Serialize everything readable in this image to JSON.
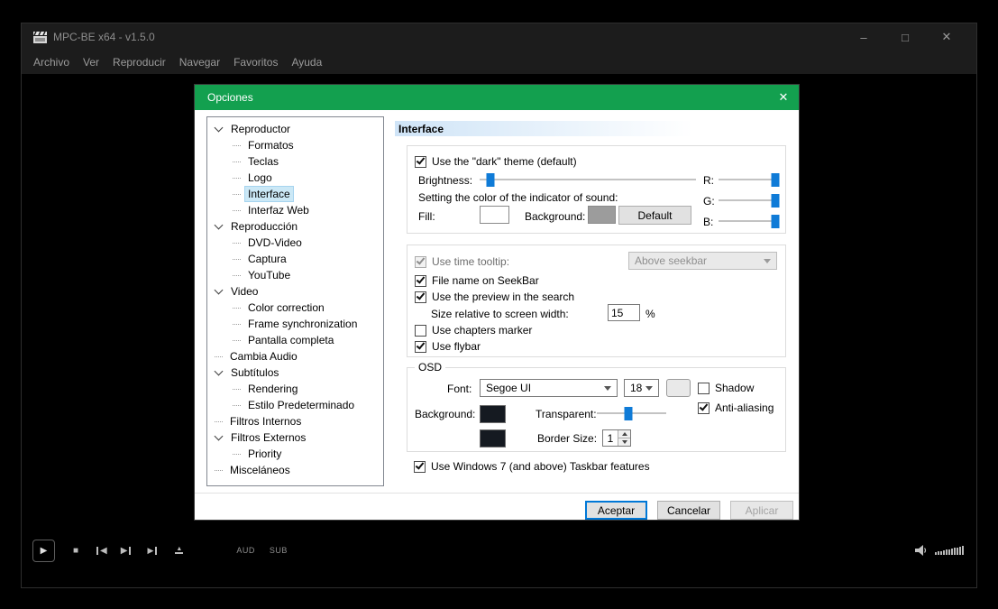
{
  "colors": {
    "dialog_titlebar_green": "#13a04f",
    "accent_blue": "#0078d7",
    "tree_selection": "#cbe8f6",
    "window_chrome": "#1c1c1c"
  },
  "window": {
    "title": "MPC-BE x64 - v1.5.0",
    "menu": [
      "Archivo",
      "Ver",
      "Reproducir",
      "Navegar",
      "Favoritos",
      "Ayuda"
    ],
    "controls": {
      "minimize": "–",
      "maximize": "□",
      "close": "✕"
    }
  },
  "player": {
    "play_glyph": "▶",
    "stop_glyph": "■",
    "prev_glyph": "◀",
    "next_glyph": "▶",
    "step_glyph": "▶",
    "eject_glyph": "▲",
    "aud": "AUD",
    "sub": "SUB"
  },
  "dialog": {
    "title": "Opciones",
    "close_glyph": "✕",
    "page_title": "Interface",
    "tree": [
      {
        "label": "Reproductor"
      },
      {
        "label": "Formatos"
      },
      {
        "label": "Teclas"
      },
      {
        "label": "Logo"
      },
      {
        "label": "Interface"
      },
      {
        "label": "Interfaz Web"
      },
      {
        "label": "Reproducción"
      },
      {
        "label": "DVD-Video"
      },
      {
        "label": "Captura"
      },
      {
        "label": "YouTube"
      },
      {
        "label": "Video"
      },
      {
        "label": "Color correction"
      },
      {
        "label": "Frame synchronization"
      },
      {
        "label": "Pantalla completa"
      },
      {
        "label": "Cambia Audio"
      },
      {
        "label": "Subtítulos"
      },
      {
        "label": "Rendering"
      },
      {
        "label": "Estilo Predeterminado"
      },
      {
        "label": "Filtros Internos"
      },
      {
        "label": "Filtros Externos"
      },
      {
        "label": "Priority"
      },
      {
        "label": "Misceláneos"
      }
    ],
    "theme": {
      "dark_theme_label": "Use the \"dark\" theme (default)",
      "brightness_label": "Brightness:",
      "indicator_label": "Setting the color of the indicator of sound:",
      "fill_label": "Fill:",
      "background_label": "Background:",
      "default_button": "Default",
      "r_label": "R:",
      "g_label": "G:",
      "b_label": "B:",
      "fill_color": "#ffffff",
      "background_color": "#9c9c9c"
    },
    "seekbar": {
      "tooltip_label": "Use time tooltip:",
      "tooltip_value": "Above seekbar",
      "filename_label": "File name on SeekBar",
      "preview_label": "Use the preview in the search",
      "size_label": "Size relative to screen width:",
      "size_value": "15",
      "percent": "%",
      "chapters_label": "Use chapters marker",
      "flybar_label": "Use flybar"
    },
    "osd": {
      "legend": "OSD",
      "font_label": "Font:",
      "font_value": "Segoe UI",
      "font_size": "18",
      "shadow_label": "Shadow",
      "antialias_label": "Anti-aliasing",
      "background_label": "Background:",
      "transparent_label": "Transparent:",
      "border_size_label": "Border Size:",
      "border_size_value": "1",
      "text_color_swatch": "#e9e9e9",
      "background_swatch": "#151a21",
      "border_swatch": "#151a21"
    },
    "taskbar_label": "Use Windows 7 (and above) Taskbar features",
    "buttons": {
      "ok": "Aceptar",
      "cancel": "Cancelar",
      "apply": "Aplicar"
    },
    "sliders": {
      "brightness": "5%",
      "r": "97%",
      "g": "97%",
      "b": "97%",
      "transparent": "45%"
    }
  }
}
